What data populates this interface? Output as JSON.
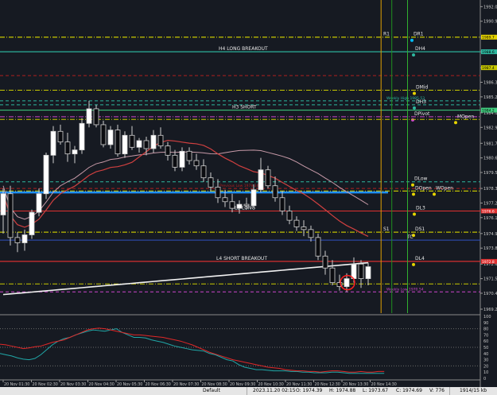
{
  "chart_data": {
    "type": "candlestick",
    "colors": {
      "background": "#161a22",
      "bull_candle": "#ffffff",
      "bear_candle": "#0b0c10",
      "candle_outline": "#cfcfcf",
      "long_ma": "#f2f2f2",
      "mid_ma": "#d04040",
      "slow_ma": "#c79aa8",
      "osc_main": "#e02828",
      "osc_signal": "#20a8a8"
    },
    "y_axis_ticks": [
      "1992.0",
      "1990.9",
      "1989.7",
      "1988.6",
      "1987.4",
      "1986.3",
      "1985.2",
      "1984.0",
      "1982.9",
      "1981.7",
      "1980.6",
      "1979.5",
      "1978.3",
      "1977.2",
      "1976.1",
      "1974.9",
      "1973.8",
      "1972.6",
      "1971.5",
      "1970.4",
      "1969.2"
    ],
    "ylim": [
      1968.9,
      1992.5
    ],
    "x_axis_labels": [
      "20 Nov 01:30",
      "20 Nov 02:30",
      "20 Nov 03:30",
      "20 Nov 04:30",
      "20 Nov 05:30",
      "20 Nov 06:30",
      "20 Nov 07:30",
      "20 Nov 08:30",
      "20 Nov 09:30",
      "20 Nov 10:30",
      "20 Nov 11:30",
      "20 Nov 12:30",
      "20 Nov 13:30",
      "20 Nov 14:30"
    ],
    "candles": [
      {
        "o": 1976.3,
        "h": 1978.3,
        "l": 1974.9,
        "c": 1977.9
      },
      {
        "o": 1977.9,
        "h": 1978.5,
        "l": 1974.0,
        "c": 1974.6
      },
      {
        "o": 1974.6,
        "h": 1975.0,
        "l": 1973.5,
        "c": 1974.2
      },
      {
        "o": 1974.2,
        "h": 1975.2,
        "l": 1973.6,
        "c": 1974.8
      },
      {
        "o": 1974.8,
        "h": 1976.7,
        "l": 1974.5,
        "c": 1976.5
      },
      {
        "o": 1976.5,
        "h": 1978.3,
        "l": 1976.2,
        "c": 1977.9
      },
      {
        "o": 1977.9,
        "h": 1981.0,
        "l": 1977.5,
        "c": 1980.8
      },
      {
        "o": 1980.8,
        "h": 1983.0,
        "l": 1980.2,
        "c": 1982.6
      },
      {
        "o": 1982.6,
        "h": 1983.1,
        "l": 1981.6,
        "c": 1981.8
      },
      {
        "o": 1981.8,
        "h": 1982.5,
        "l": 1980.3,
        "c": 1980.9
      },
      {
        "o": 1980.9,
        "h": 1981.5,
        "l": 1980.2,
        "c": 1981.2
      },
      {
        "o": 1981.2,
        "h": 1983.6,
        "l": 1980.9,
        "c": 1983.2
      },
      {
        "o": 1983.2,
        "h": 1984.9,
        "l": 1982.9,
        "c": 1984.3
      },
      {
        "o": 1984.3,
        "h": 1984.6,
        "l": 1982.9,
        "c": 1983.1
      },
      {
        "o": 1983.1,
        "h": 1983.4,
        "l": 1981.4,
        "c": 1981.6
      },
      {
        "o": 1981.6,
        "h": 1983.0,
        "l": 1981.3,
        "c": 1982.7
      },
      {
        "o": 1982.7,
        "h": 1983.1,
        "l": 1980.7,
        "c": 1980.9
      },
      {
        "o": 1980.9,
        "h": 1982.6,
        "l": 1980.6,
        "c": 1982.3
      },
      {
        "o": 1982.3,
        "h": 1983.0,
        "l": 1981.2,
        "c": 1981.4
      },
      {
        "o": 1981.4,
        "h": 1982.1,
        "l": 1981.0,
        "c": 1981.9
      },
      {
        "o": 1981.9,
        "h": 1982.2,
        "l": 1980.8,
        "c": 1981.3
      },
      {
        "o": 1981.3,
        "h": 1982.7,
        "l": 1981.0,
        "c": 1982.3
      },
      {
        "o": 1982.3,
        "h": 1982.9,
        "l": 1981.3,
        "c": 1981.5
      },
      {
        "o": 1981.5,
        "h": 1981.8,
        "l": 1980.4,
        "c": 1980.8
      },
      {
        "o": 1980.8,
        "h": 1981.2,
        "l": 1979.6,
        "c": 1979.9
      },
      {
        "o": 1979.9,
        "h": 1981.4,
        "l": 1979.6,
        "c": 1981.1
      },
      {
        "o": 1981.1,
        "h": 1981.4,
        "l": 1980.1,
        "c": 1980.4
      },
      {
        "o": 1980.4,
        "h": 1980.9,
        "l": 1979.7,
        "c": 1980.0
      },
      {
        "o": 1980.0,
        "h": 1980.5,
        "l": 1978.8,
        "c": 1979.1
      },
      {
        "o": 1979.1,
        "h": 1979.5,
        "l": 1978.1,
        "c": 1978.4
      },
      {
        "o": 1978.4,
        "h": 1979.0,
        "l": 1977.2,
        "c": 1977.6
      },
      {
        "o": 1977.6,
        "h": 1978.2,
        "l": 1976.9,
        "c": 1977.3
      },
      {
        "o": 1977.3,
        "h": 1977.9,
        "l": 1976.5,
        "c": 1976.8
      },
      {
        "o": 1976.8,
        "h": 1977.4,
        "l": 1976.4,
        "c": 1977.1
      },
      {
        "o": 1977.1,
        "h": 1977.6,
        "l": 1976.7,
        "c": 1977.0
      },
      {
        "o": 1977.0,
        "h": 1978.6,
        "l": 1976.8,
        "c": 1978.2
      },
      {
        "o": 1978.2,
        "h": 1980.6,
        "l": 1978.0,
        "c": 1979.7
      },
      {
        "o": 1979.7,
        "h": 1980.0,
        "l": 1978.3,
        "c": 1978.5
      },
      {
        "o": 1978.5,
        "h": 1979.2,
        "l": 1977.3,
        "c": 1977.6
      },
      {
        "o": 1977.6,
        "h": 1978.1,
        "l": 1976.3,
        "c": 1976.6
      },
      {
        "o": 1976.6,
        "h": 1977.0,
        "l": 1975.6,
        "c": 1975.9
      },
      {
        "o": 1975.9,
        "h": 1976.2,
        "l": 1975.1,
        "c": 1975.4
      },
      {
        "o": 1975.4,
        "h": 1975.9,
        "l": 1974.7,
        "c": 1975.2
      },
      {
        "o": 1975.2,
        "h": 1975.5,
        "l": 1974.3,
        "c": 1974.6
      },
      {
        "o": 1974.6,
        "h": 1974.9,
        "l": 1972.9,
        "c": 1973.2
      },
      {
        "o": 1973.2,
        "h": 1973.6,
        "l": 1971.8,
        "c": 1972.3
      },
      {
        "o": 1972.3,
        "h": 1972.9,
        "l": 1971.0,
        "c": 1971.2
      },
      {
        "o": 1971.2,
        "h": 1971.8,
        "l": 1970.6,
        "c": 1970.9
      },
      {
        "o": 1970.9,
        "h": 1971.9,
        "l": 1970.5,
        "c": 1971.5
      },
      {
        "o": 1971.5,
        "h": 1973.1,
        "l": 1971.2,
        "c": 1972.6
      },
      {
        "o": 1972.6,
        "h": 1972.9,
        "l": 1970.8,
        "c": 1971.5
      },
      {
        "o": 1971.5,
        "h": 1972.7,
        "l": 1971.0,
        "c": 1972.4
      }
    ],
    "levels": [
      {
        "label": "DR1",
        "price": 1989.7,
        "color": "#c8c800",
        "style": "dashdot"
      },
      {
        "label": "R1",
        "price": 1989.7,
        "color": "#c8c800",
        "style": "dashdot"
      },
      {
        "label": "DH4",
        "price": 1988.6,
        "color": "#2eb8a0",
        "style": "solid"
      },
      {
        "label": "H4 LONG BREAKOUT",
        "price": 1988.6,
        "color": "#2eb8a0",
        "style": "solid"
      },
      {
        "label": "",
        "price": 1986.8,
        "color": "#b02020",
        "style": "dashed"
      },
      {
        "label": "DMid",
        "price": 1985.7,
        "color": "#c8c800",
        "style": "dashdot"
      },
      {
        "label": "Weekly High 1985.53",
        "price": 1984.9,
        "color": "#2eb8a0",
        "style": "dashed"
      },
      {
        "label": "DH3",
        "price": 1984.6,
        "color": "#2eb8a0",
        "style": "dashed"
      },
      {
        "label": "H3 SHORT",
        "price": 1984.2,
        "color": "#40d080",
        "style": "solid"
      },
      {
        "label": "DPivot",
        "price": 1983.7,
        "color": "#cc44cc",
        "style": "dashdot"
      },
      {
        "label": "MOpen",
        "price": 1983.5,
        "color": "#c8c800",
        "style": "dashdot"
      },
      {
        "label": "DLow",
        "price": 1978.8,
        "color": "#2eb8a0",
        "style": "dashed"
      },
      {
        "label": "Previous Low 1978.34",
        "price": 1978.3,
        "color": "#b02020",
        "style": "dashed"
      },
      {
        "label": "DOpen",
        "price": 1978.1,
        "color": "#c8c800",
        "style": "dashdot"
      },
      {
        "label": "WOpen",
        "price": 1978.1,
        "color": "#c8c800",
        "style": "dashdot"
      },
      {
        "label": "",
        "price": 1978.0,
        "color": "#1e90ff",
        "style": "solid"
      },
      {
        "label": "DL3",
        "price": 1976.6,
        "color": "#e03030",
        "style": "solid"
      },
      {
        "label": "L3 LONG",
        "price": 1976.6,
        "color": "#e03030",
        "style": "solid"
      },
      {
        "label": "DS1",
        "price": 1975.0,
        "color": "#c8c800",
        "style": "dashdot"
      },
      {
        "label": "S1",
        "price": 1975.0,
        "color": "#c8c800",
        "style": "dashdot"
      },
      {
        "label": "TC",
        "price": 1974.4,
        "color": "#3050c0",
        "style": "solid"
      },
      {
        "label": "DL4",
        "price": 1972.8,
        "color": "#e03030",
        "style": "solid"
      },
      {
        "label": "L4 SHORT BREAKOUT",
        "price": 1972.8,
        "color": "#e03030",
        "style": "solid"
      },
      {
        "label": "",
        "price": 1971.1,
        "color": "#c8c800",
        "style": "dashdot"
      },
      {
        "label": "Weekly Low 1970.54",
        "price": 1970.5,
        "color": "#cc44cc",
        "style": "dashed"
      }
    ],
    "price_badges": [
      {
        "price": 1989.7,
        "text": "1989.7",
        "bg": "#e6d400",
        "fg": "#000"
      },
      {
        "price": 1988.6,
        "text": "1988.6",
        "bg": "#2eb8a0",
        "fg": "#000"
      },
      {
        "price": 1987.4,
        "text": "1987.4",
        "bg": "#c8c800",
        "fg": "#000"
      },
      {
        "price": 1984.2,
        "text": "1984.2",
        "bg": "#40d080",
        "fg": "#000"
      },
      {
        "price": 1976.6,
        "text": "1976.6",
        "bg": "#e03030",
        "fg": "#fff"
      },
      {
        "price": 1972.8,
        "text": "1972.8",
        "bg": "#e03030",
        "fg": "#fff"
      }
    ],
    "oscillator": {
      "ylim": [
        0,
        100
      ],
      "ticks": [
        "100",
        "90",
        "80",
        "70",
        "60",
        "50",
        "40",
        "30",
        "20",
        "10",
        "0"
      ],
      "main": [
        55,
        54,
        52,
        50,
        48,
        49,
        51,
        52,
        55,
        58,
        60,
        62,
        66,
        70,
        74,
        78,
        80,
        81,
        80,
        78,
        76,
        74,
        72,
        70,
        70,
        69,
        68,
        67,
        66,
        64,
        62,
        60,
        57,
        54,
        50,
        46,
        42,
        39,
        36,
        33,
        30,
        28,
        26,
        24,
        22,
        20,
        18,
        17,
        16,
        14,
        13,
        12,
        12,
        11,
        11,
        10,
        11,
        12,
        12,
        11,
        10,
        10,
        11,
        10,
        10,
        11,
        11
      ],
      "signal": [
        40,
        38,
        36,
        33,
        31,
        30,
        32,
        38,
        46,
        54,
        60,
        64,
        66,
        70,
        73,
        76,
        78,
        77,
        76,
        78,
        80,
        74,
        70,
        66,
        66,
        65,
        62,
        60,
        58,
        55,
        52,
        50,
        48,
        46,
        45,
        44,
        40,
        38,
        34,
        30,
        28,
        22,
        18,
        16,
        14,
        14,
        13,
        12,
        12,
        12,
        11,
        11,
        10,
        10,
        9,
        9,
        9,
        10,
        10,
        9,
        8,
        8,
        8,
        8,
        8,
        8,
        8
      ]
    },
    "vertical_lines": [
      {
        "price_top": 1992.5,
        "color": "#e0a000",
        "index": 52.8
      },
      {
        "price_top": 1992.5,
        "color": "#1f8f1f",
        "index": 54.3
      },
      {
        "price_top": 1992.5,
        "color": "#30b030",
        "index": 56.5
      }
    ]
  },
  "status_bar": {
    "profile": "Default",
    "datetime": "2023.11.20 02:15",
    "open": "O: 1974.39",
    "high": "H: 1974.88",
    "low": "L: 1973.67",
    "close": "C: 1974.69",
    "volume": "V: 776",
    "traffic": "1914/15 kb"
  }
}
